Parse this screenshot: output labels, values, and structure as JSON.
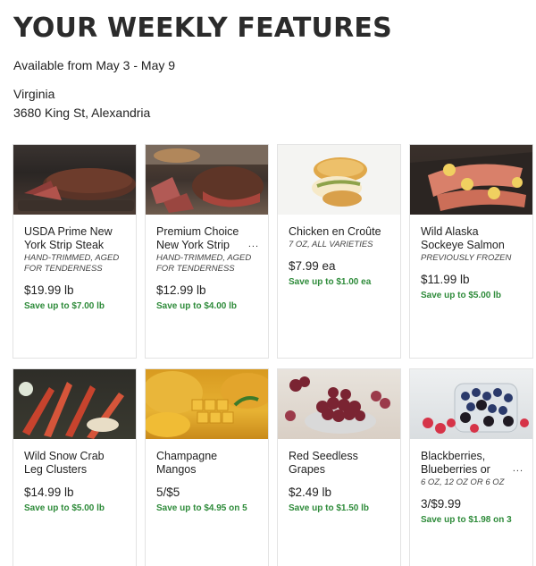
{
  "header": {
    "title": "YOUR WEEKLY FEATURES",
    "dates": "Available from May 3 - May 9",
    "state": "Virginia",
    "address": "3680 King St, Alexandria"
  },
  "products": [
    {
      "name": "USDA Prime New York Strip Steak",
      "desc": "HAND-TRIMMED, AGED FOR TENDERNESS",
      "price": "$19.99 lb",
      "save": "Save up to $7.00 lb",
      "more": "",
      "image_icon": "steak-image"
    },
    {
      "name": "Premium Choice New York Strip",
      "desc": "HAND-TRIMMED, AGED FOR TENDERNESS",
      "price": "$12.99 lb",
      "save": "Save up to $4.00 lb",
      "more": "...",
      "image_icon": "steak-image"
    },
    {
      "name": "Chicken en Croûte",
      "desc": "7 OZ, ALL VARIETIES",
      "price": "$7.99 ea",
      "save": "Save up to $1.00 ea",
      "more": "",
      "image_icon": "chicken-image"
    },
    {
      "name": "Wild Alaska Sockeye Salmon",
      "desc": "PREVIOUSLY FROZEN",
      "price": "$11.99 lb",
      "save": "Save up to $5.00 lb",
      "more": "",
      "image_icon": "salmon-image"
    },
    {
      "name": "Wild Snow Crab Leg Clusters",
      "desc": "",
      "price": "$14.99 lb",
      "save": "Save up to $5.00 lb",
      "more": "",
      "image_icon": "crab-image"
    },
    {
      "name": "Champagne Mangos",
      "desc": "",
      "price": "5/$5",
      "save": "Save up to $4.95 on 5",
      "more": "",
      "image_icon": "mango-image"
    },
    {
      "name": "Red Seedless Grapes",
      "desc": "",
      "price": "$2.49 lb",
      "save": "Save up to $1.50 lb",
      "more": "",
      "image_icon": "grapes-image"
    },
    {
      "name": "Blackberries, Blueberries or",
      "desc": "6 OZ, 12 OZ OR 6 OZ",
      "price": "3/$9.99",
      "save": "Save up to $1.98 on 3",
      "more": "...",
      "image_icon": "berries-image"
    }
  ],
  "colors": {
    "save_green": "#2e8b3a",
    "title": "#2b2b2b"
  }
}
